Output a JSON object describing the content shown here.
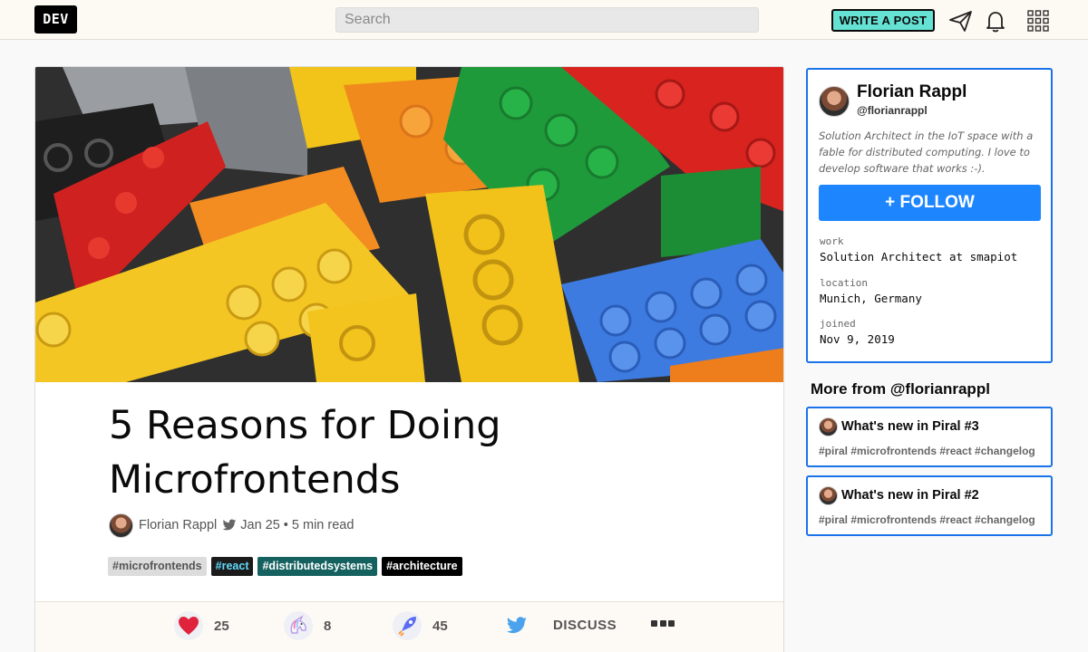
{
  "header": {
    "logo_text": "DEV",
    "search_placeholder": "Search",
    "write_button": "WRITE A POST",
    "icons": [
      "send-icon",
      "bell-icon",
      "apps-grid-icon"
    ]
  },
  "article": {
    "cover_alt": "lego-bricks-cover",
    "title": "5 Reasons for Doing Microfrontends",
    "author": "Florian Rappl",
    "date": "Jan 25",
    "read_time": "• 5 min read",
    "tags": [
      "#microfrontends",
      "#react",
      "#distributedsystems",
      "#architecture"
    ],
    "reactions": {
      "hearts": "25",
      "unicorns": "8",
      "bookmarks": "45"
    },
    "discuss_label": "DISCUSS"
  },
  "profile": {
    "name": "Florian Rappl",
    "handle": "@florianrappl",
    "bio": "Solution Architect in the IoT space with a fable for distributed computing. I love to develop software that works :-).",
    "follow_label": "+ FOLLOW",
    "work_label": "work",
    "work_value": "Solution Architect at smapiot",
    "location_label": "location",
    "location_value": "Munich, Germany",
    "joined_label": "joined",
    "joined_value": "Nov 9, 2019"
  },
  "more_from": {
    "heading": "More from @florianrappl",
    "posts": [
      {
        "title": "What's new in Piral #3",
        "tags": "#piral #microfrontends #react #changelog"
      },
      {
        "title": "What's new in Piral #2",
        "tags": "#piral #microfrontends #react #changelog"
      }
    ]
  },
  "colors": {
    "accent_blue": "#1d86ff",
    "write_button_bg": "#66e2d5",
    "heart_red": "#e0233d"
  }
}
